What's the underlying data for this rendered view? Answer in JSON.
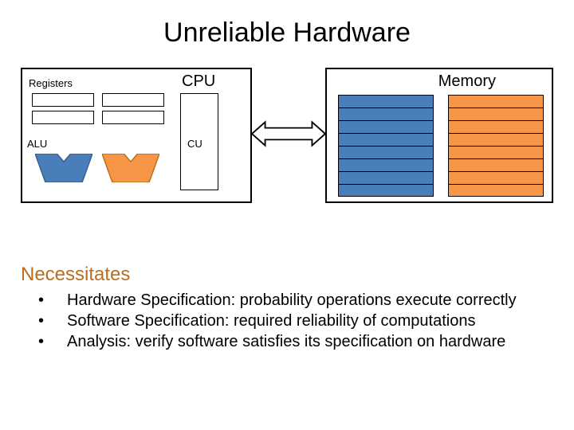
{
  "title": "Unreliable Hardware",
  "cpu": {
    "label": "CPU",
    "registers_label": "Registers",
    "alu_label": "ALU",
    "cu_label": "CU"
  },
  "memory": {
    "label": "Memory"
  },
  "colors": {
    "blue": "#4a7ebb",
    "orange": "#f79646"
  },
  "subheading": "Necessitates",
  "bullets": [
    "Hardware Specification: probability operations execute correctly",
    "Software Specification: required reliability of computations",
    "Analysis: verify software satisfies its specification on hardware"
  ]
}
